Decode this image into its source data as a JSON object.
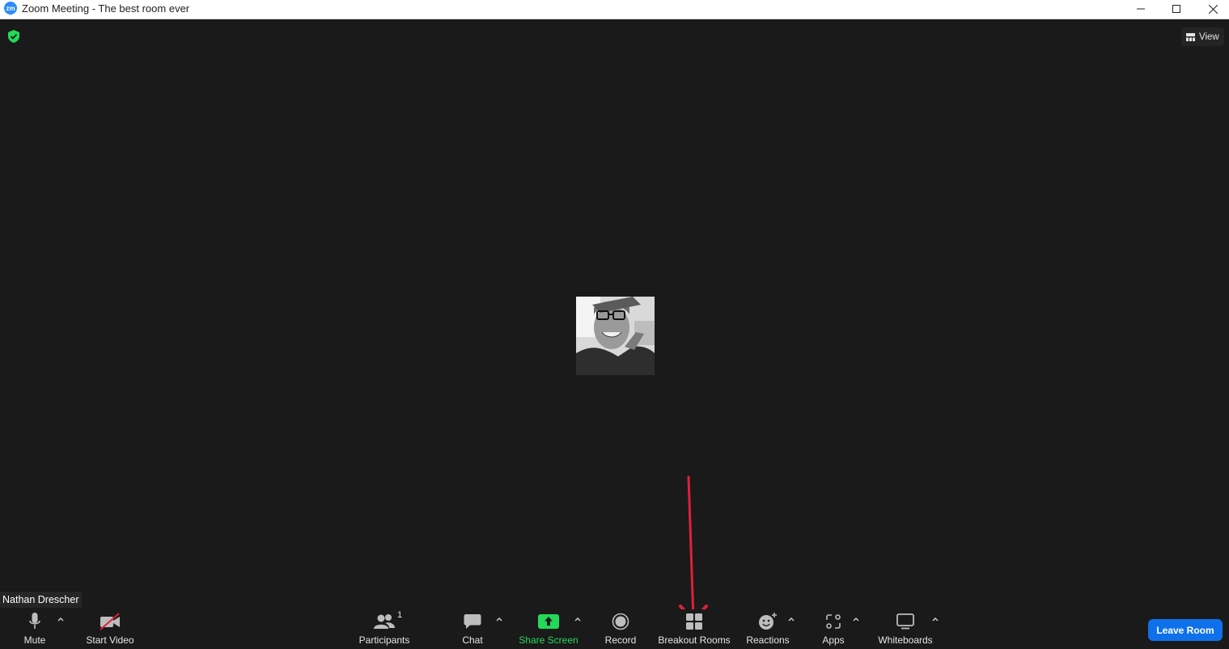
{
  "window": {
    "app_logo": "zm",
    "title": "Zoom Meeting - The best room ever"
  },
  "top_bar": {
    "view_label": "View"
  },
  "participant": {
    "name": "Nathan Drescher"
  },
  "toolbar": {
    "mute_label": "Mute",
    "start_video_label": "Start Video",
    "participants_label": "Participants",
    "participants_count": "1",
    "chat_label": "Chat",
    "share_screen_label": "Share Screen",
    "record_label": "Record",
    "breakout_rooms_label": "Breakout Rooms",
    "reactions_label": "Reactions",
    "apps_label": "Apps",
    "whiteboards_label": "Whiteboards",
    "leave_label": "Leave Room"
  },
  "colors": {
    "background": "#1a1a1a",
    "share_green": "#23d959",
    "leave_blue": "#0e71eb",
    "annotation_red": "#e0203a"
  }
}
